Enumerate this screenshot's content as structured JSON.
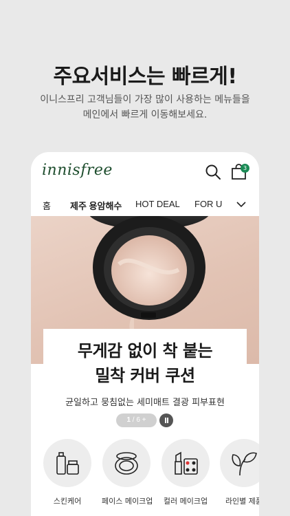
{
  "promo": {
    "headline": "주요서비스는 빠르게!",
    "subline_1": "이니스프리 고객님들이 가장 많이 사용하는 메뉴들을",
    "subline_2": "메인에서 빠르게 이동해보세요."
  },
  "app": {
    "logo": "innisfree",
    "cart_count": "3"
  },
  "tabs": [
    {
      "label": "홈",
      "active": false
    },
    {
      "label": "제주 용암해수",
      "active": true
    },
    {
      "label": "HOT DEAL",
      "active": false
    },
    {
      "label": "FOR U",
      "active": false
    }
  ],
  "banner": {
    "title_1": "무게감 없이 착 붙는",
    "title_2": "밀착 커버 쿠션",
    "subtitle": "균일하고 뭉침없는 세미매트 결광 피부표현",
    "pager_current": "1",
    "pager_sep": " / ",
    "pager_total": "6",
    "pager_more": "+"
  },
  "categories": [
    {
      "label": "스킨케어",
      "icon": "bottles-icon"
    },
    {
      "label": "페이스 메이크업",
      "icon": "compact-icon"
    },
    {
      "label": "컬러 메이크업",
      "icon": "lipstick-palette-icon"
    },
    {
      "label": "라인별 제품",
      "icon": "leaf-icon"
    }
  ],
  "colors": {
    "logo": "#1d4d2d",
    "badge": "#1a8a55",
    "background": "#e9e9e9"
  }
}
